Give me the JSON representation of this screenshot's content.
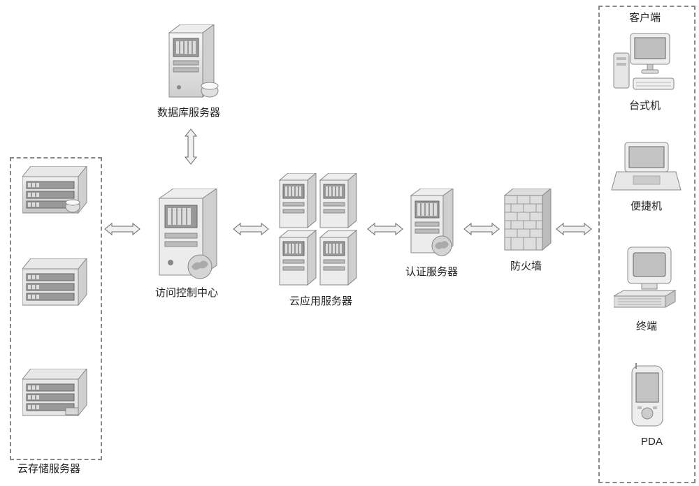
{
  "labels": {
    "cloud_storage": "云存储服务器",
    "db_server": "数据库服务器",
    "access_center": "访问控制中心",
    "cloud_app": "云应用服务器",
    "auth_server": "认证服务器",
    "firewall": "防火墙",
    "clients_title": "客户端",
    "desktop": "台式机",
    "laptop": "便捷机",
    "terminal": "终端",
    "pda": "PDA"
  },
  "diagram_nodes": [
    {
      "id": "cloud_storage_group",
      "label_key": "cloud_storage"
    },
    {
      "id": "db_server",
      "label_key": "db_server"
    },
    {
      "id": "access_center",
      "label_key": "access_center"
    },
    {
      "id": "cloud_app",
      "label_key": "cloud_app"
    },
    {
      "id": "auth_server",
      "label_key": "auth_server"
    },
    {
      "id": "firewall",
      "label_key": "firewall"
    },
    {
      "id": "clients_group",
      "label_key": "clients_title",
      "children": [
        "desktop",
        "laptop",
        "terminal",
        "pda"
      ]
    }
  ],
  "connections": [
    [
      "cloud_storage_group",
      "access_center",
      "bi"
    ],
    [
      "db_server",
      "access_center",
      "bi"
    ],
    [
      "access_center",
      "cloud_app",
      "bi"
    ],
    [
      "cloud_app",
      "auth_server",
      "bi"
    ],
    [
      "auth_server",
      "firewall",
      "bi"
    ],
    [
      "firewall",
      "clients_group",
      "bi"
    ]
  ]
}
